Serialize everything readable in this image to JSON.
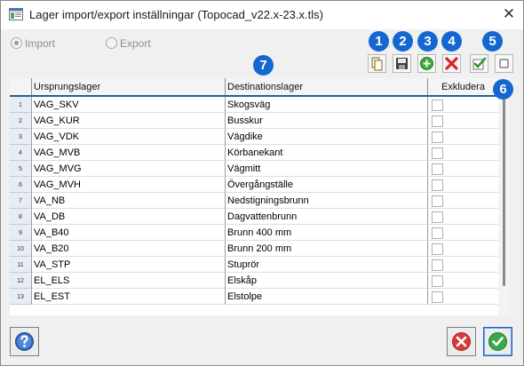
{
  "window": {
    "title": "Lager import/export inställningar (Topocad_v22.x-23.x.tls)",
    "close_symbol": "✕"
  },
  "mode": {
    "import_label": "Import",
    "export_label": "Export",
    "selected": "Import"
  },
  "toolbar": {
    "badges": [
      "1",
      "2",
      "3",
      "4",
      "5",
      "6",
      "7"
    ],
    "buttons": [
      {
        "name": "copy-button",
        "icon": "copy-icon"
      },
      {
        "name": "save-button",
        "icon": "floppy-disk-icon"
      },
      {
        "name": "add-row-button",
        "icon": "plus-circle-icon"
      },
      {
        "name": "delete-row-button",
        "icon": "red-x-icon"
      },
      {
        "name": "check-all-button",
        "icon": "green-check-icon"
      },
      {
        "name": "uncheck-all-button",
        "icon": "empty-square-icon"
      }
    ]
  },
  "grid": {
    "columns": [
      "Ursprungslager",
      "Destinationslager",
      "Exkludera"
    ],
    "rows": [
      {
        "n": "1",
        "source": "VAG_SKV",
        "dest": "Skogsväg",
        "exclude": false
      },
      {
        "n": "2",
        "source": "VAG_KUR",
        "dest": "Busskur",
        "exclude": false
      },
      {
        "n": "3",
        "source": "VAG_VDK",
        "dest": "Vägdike",
        "exclude": false
      },
      {
        "n": "4",
        "source": "VAG_MVB",
        "dest": "Körbanekant",
        "exclude": false
      },
      {
        "n": "5",
        "source": "VAG_MVG",
        "dest": "Vägmitt",
        "exclude": false
      },
      {
        "n": "6",
        "source": "VAG_MVH",
        "dest": "Övergångställe",
        "exclude": false
      },
      {
        "n": "7",
        "source": "VA_NB",
        "dest": "Nedstigningsbrunn",
        "exclude": false
      },
      {
        "n": "8",
        "source": "VA_DB",
        "dest": "Dagvattenbrunn",
        "exclude": false
      },
      {
        "n": "9",
        "source": "VA_B40",
        "dest": "Brunn 400 mm",
        "exclude": false
      },
      {
        "n": "10",
        "source": "VA_B20",
        "dest": "Brunn 200 mm",
        "exclude": false
      },
      {
        "n": "11",
        "source": "VA_STP",
        "dest": "Stuprör",
        "exclude": false
      },
      {
        "n": "12",
        "source": "EL_ELS",
        "dest": "Elskåp",
        "exclude": false
      },
      {
        "n": "13",
        "source": "EL_EST",
        "dest": "Elstolpe",
        "exclude": false
      }
    ]
  },
  "footer": {
    "help_icon": "help-icon",
    "cancel_icon": "cancel-icon",
    "ok_icon": "ok-icon"
  },
  "colors": {
    "badge": "#1467d2",
    "header_underline": "#2c5d96",
    "cancel_red": "#d9393c",
    "ok_green": "#38a94a"
  }
}
